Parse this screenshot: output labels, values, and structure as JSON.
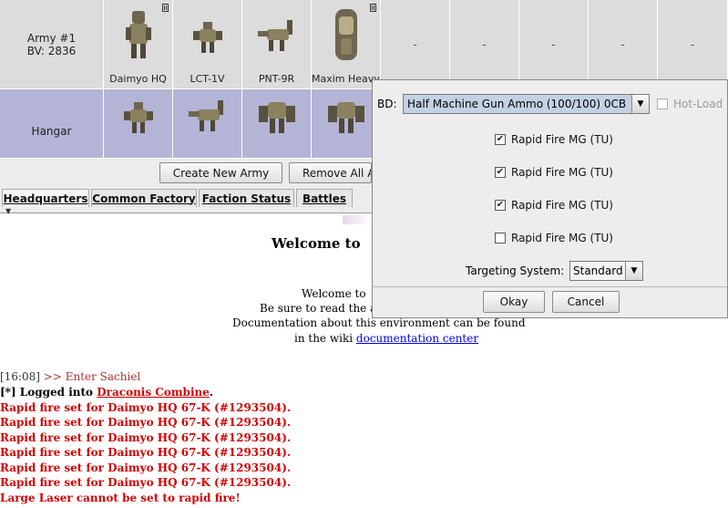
{
  "army": {
    "title": "Army #1",
    "bv": "BV: 2836",
    "units": [
      "Daimyo HQ",
      "LCT-1V",
      "PNT-9R",
      "Maxim Heavy Hover Transport"
    ],
    "empty_slot": "-"
  },
  "hangar": {
    "label": "Hangar"
  },
  "buttons": {
    "create_army": "Create New Army",
    "remove_all": "Remove All Armies"
  },
  "tabs": [
    {
      "label": "Headquarters"
    },
    {
      "label": "Common Factory"
    },
    {
      "label": "Faction Status"
    },
    {
      "label": "Battles"
    }
  ],
  "welcome": {
    "heading": "Welcome to",
    "line1": "Welcome to",
    "line2": "Be sure to read the a",
    "line3": "Documentation about this environment can be found",
    "line4_prefix": "in the wiki",
    "link": "documentation center"
  },
  "log": {
    "time": "[16:08]",
    "enter": ">> Enter Sachiel",
    "login_prefix": "[*] Logged into",
    "faction": "Draconis Combine",
    "rapid_msg": "Rapid fire set for Daimyo HQ 67-K (#1293504).",
    "laser_msg": "Large Laser cannot be set to rapid fire!"
  },
  "dialog": {
    "bd_label": "BD:",
    "ammo_value": "Half Machine Gun Ammo (100/100) 0CB",
    "hot_load": "Hot-Load",
    "options": [
      {
        "label": "Rapid Fire MG (TU)",
        "checked": true
      },
      {
        "label": "Rapid Fire MG (TU)",
        "checked": true
      },
      {
        "label": "Rapid Fire MG (TU)",
        "checked": true
      },
      {
        "label": "Rapid Fire MG (TU)",
        "checked": false
      }
    ],
    "targeting_label": "Targeting System:",
    "targeting_value": "Standard",
    "okay": "Okay",
    "cancel": "Cancel"
  },
  "colors": {
    "army_row": "#dcdcdc",
    "hangar_row": "#b4b4d6",
    "log_red": "#d20000",
    "link": "#0000ee"
  }
}
